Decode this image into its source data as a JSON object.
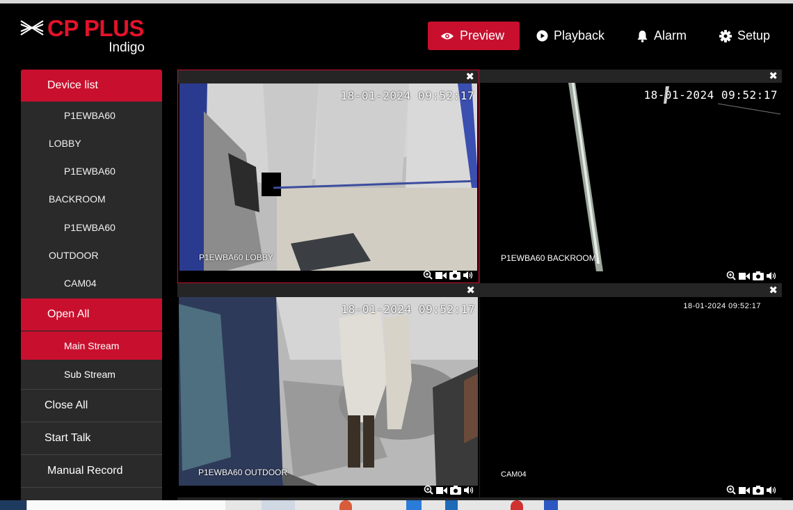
{
  "brand": {
    "name": "CP PLUS",
    "sub": "Indigo",
    "accent": "#c8102e"
  },
  "nav": [
    {
      "label": "Preview",
      "icon": "eye-icon",
      "active": true
    },
    {
      "label": "Playback",
      "icon": "play-circle-icon"
    },
    {
      "label": "Alarm",
      "icon": "bell-icon"
    },
    {
      "label": "Setup",
      "icon": "gear-icon"
    }
  ],
  "sidebar": {
    "device_list": "Device list",
    "tree": [
      "P1EWBA60",
      "LOBBY",
      "P1EWBA60",
      "BACKROOM",
      "P1EWBA60",
      "OUTDOOR",
      "CAM04"
    ],
    "open_all": "Open All",
    "main_stream": "Main Stream",
    "sub_stream": "Sub Stream",
    "close_all": "Close All",
    "start_talk": "Start Talk",
    "manual_record": "Manual Record"
  },
  "cameras": [
    {
      "label": "P1EWBA60 LOBBY",
      "timestamp": "18-01-2024 09:52:17"
    },
    {
      "label": "P1EWBA60 BACKROOM",
      "timestamp": "18-01-2024 09:52:17"
    },
    {
      "label": "P1EWBA60 OUTDOOR",
      "timestamp": "18-01-2024 09:52:17"
    },
    {
      "label": "CAM04",
      "timestamp": "18-01-2024 09:52:17"
    }
  ],
  "cell_controls": [
    "zoom-in-icon",
    "record-icon",
    "snapshot-icon",
    "audio-icon"
  ]
}
